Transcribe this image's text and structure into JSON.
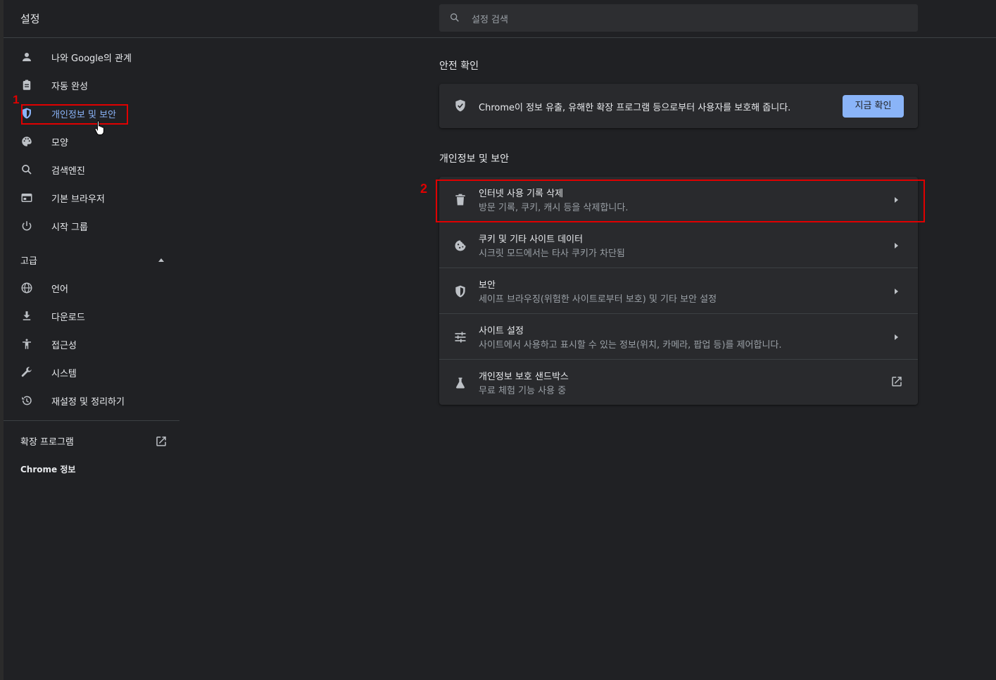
{
  "app": {
    "title": "설정"
  },
  "search": {
    "placeholder": "설정 검색"
  },
  "sidebar": {
    "items": [
      {
        "label": "나와 Google의 관계",
        "icon": "person-icon"
      },
      {
        "label": "자동 완성",
        "icon": "clipboard-icon"
      },
      {
        "label": "개인정보 및 보안",
        "icon": "shield-icon",
        "active": true
      },
      {
        "label": "모양",
        "icon": "palette-icon"
      },
      {
        "label": "검색엔진",
        "icon": "search-icon"
      },
      {
        "label": "기본 브라우저",
        "icon": "browser-icon"
      },
      {
        "label": "시작 그룹",
        "icon": "power-icon"
      }
    ],
    "advanced_label": "고급",
    "advanced_items": [
      {
        "label": "언어",
        "icon": "globe-icon"
      },
      {
        "label": "다운로드",
        "icon": "download-icon"
      },
      {
        "label": "접근성",
        "icon": "accessibility-icon"
      },
      {
        "label": "시스템",
        "icon": "wrench-icon"
      },
      {
        "label": "재설정 및 정리하기",
        "icon": "history-icon"
      }
    ],
    "extensions_label": "확장 프로그램",
    "about_label": "Chrome 정보"
  },
  "annotations": {
    "one": "1",
    "two": "2",
    "color": "#e00000"
  },
  "safety_check": {
    "heading": "안전 확인",
    "text": "Chrome이 정보 유출, 유해한 확장 프로그램 등으로부터 사용자를 보호해 줍니다.",
    "button": "지금 확인"
  },
  "privacy": {
    "heading": "개인정보 및 보안",
    "rows": [
      {
        "title": "인터넷 사용 기록 삭제",
        "subtitle": "방문 기록, 쿠키, 캐시 등을 삭제합니다.",
        "icon": "trash-icon"
      },
      {
        "title": "쿠키 및 기타 사이트 데이터",
        "subtitle": "시크릿 모드에서는 타사 쿠키가 차단됨",
        "icon": "cookie-icon"
      },
      {
        "title": "보안",
        "subtitle": "세이프 브라우징(위험한 사이트로부터 보호) 및 기타 보안 설정",
        "icon": "shield-icon"
      },
      {
        "title": "사이트 설정",
        "subtitle": "사이트에서 사용하고 표시할 수 있는 정보(위치, 카메라, 팝업 등)를 제어합니다.",
        "icon": "tune-icon"
      },
      {
        "title": "개인정보 보호 샌드박스",
        "subtitle": "무료 체험 기능 사용 중",
        "icon": "flask-icon"
      }
    ]
  },
  "colors": {
    "accent": "#8ab4f8",
    "background": "#202124",
    "card": "#292a2d"
  }
}
